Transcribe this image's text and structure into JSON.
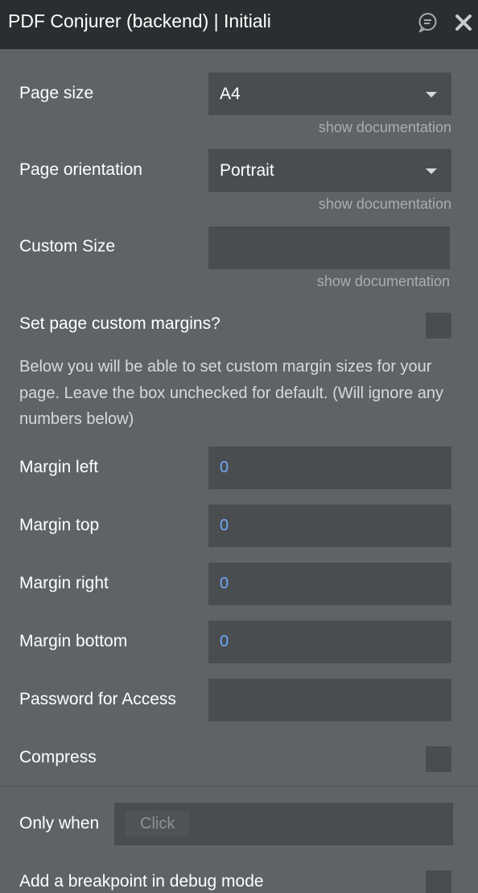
{
  "header": {
    "title": "PDF Conjurer (backend) | Initiali"
  },
  "fields": {
    "page_size": {
      "label": "Page size",
      "value": "A4",
      "doc": "show documentation"
    },
    "page_orientation": {
      "label": "Page orientation",
      "value": "Portrait",
      "doc": "show documentation"
    },
    "custom_size": {
      "label": "Custom Size",
      "value": "",
      "doc": "show documentation"
    },
    "custom_margins": {
      "label": "Set page custom margins?",
      "checked": false
    },
    "margins_description": "Below you will be able to set custom margin sizes for your page. Leave the box unchecked for default. (Will ignore any numbers below)",
    "margin_left": {
      "label": "Margin left",
      "value": "0"
    },
    "margin_top": {
      "label": "Margin top",
      "value": "0"
    },
    "margin_right": {
      "label": "Margin right",
      "value": "0"
    },
    "margin_bottom": {
      "label": "Margin bottom",
      "value": "0"
    },
    "password": {
      "label": "Password for Access",
      "value": ""
    },
    "compress": {
      "label": "Compress",
      "checked": false
    }
  },
  "conditions": {
    "only_when": {
      "label": "Only when",
      "placeholder": "Click"
    },
    "breakpoint": {
      "label": "Add a breakpoint in debug mode",
      "checked": false
    }
  },
  "colors": {
    "panel_bg": "#5f6368",
    "titlebar_bg": "#2b2e30",
    "input_bg": "#4a4d50",
    "number_value": "#6fa8f5"
  },
  "icons": {
    "comment": "comment-icon",
    "close": "close-icon",
    "dropdown": "chevron-down-icon"
  }
}
